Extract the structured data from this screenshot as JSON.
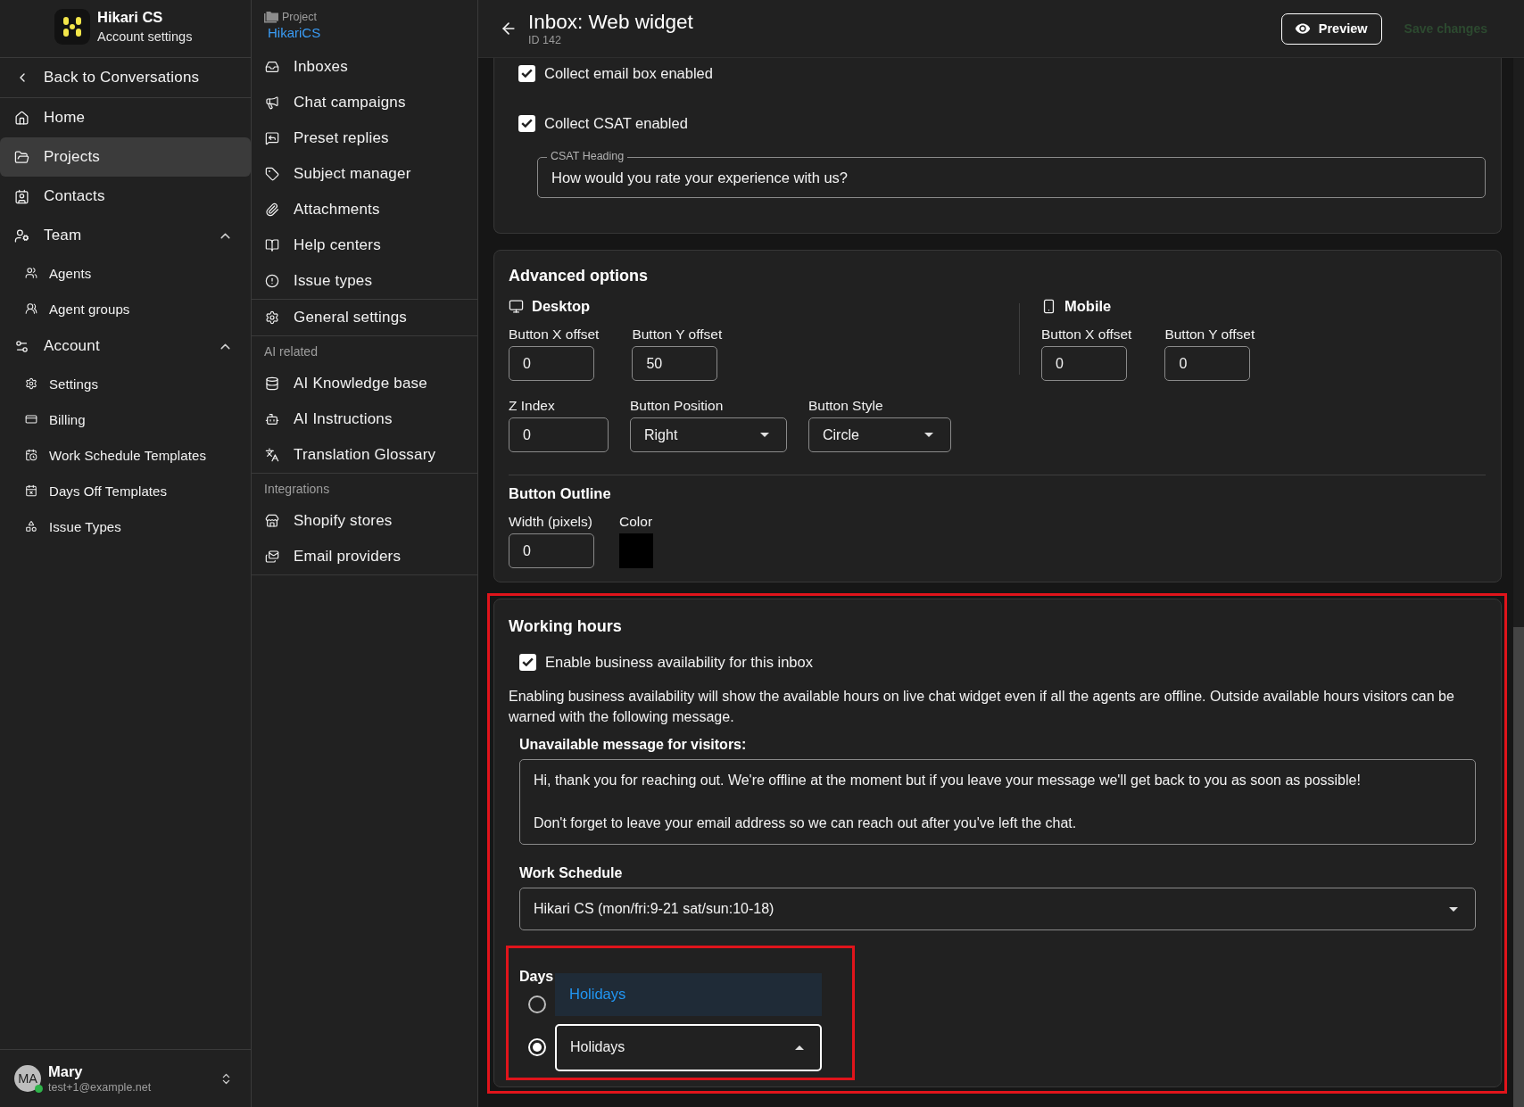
{
  "account_sidebar": {
    "brand": {
      "name": "Hikari CS",
      "subtitle": "Account settings"
    },
    "back_link": "Back to Conversations",
    "items": [
      {
        "label": "Home",
        "selected": false
      },
      {
        "label": "Projects",
        "selected": true
      },
      {
        "label": "Contacts",
        "selected": false
      },
      {
        "label": "Team",
        "selected": false,
        "expanded": true,
        "children": [
          {
            "label": "Agents",
            "selected": false
          },
          {
            "label": "Agent groups",
            "selected": false
          }
        ]
      },
      {
        "label": "Account",
        "selected": false,
        "expanded": true,
        "children": [
          {
            "label": "Settings",
            "selected": false
          },
          {
            "label": "Billing",
            "selected": false
          },
          {
            "label": "Work Schedule Templates",
            "selected": false
          },
          {
            "label": "Days Off Templates",
            "selected": false
          },
          {
            "label": "Issue Types",
            "selected": false
          }
        ]
      }
    ],
    "user": {
      "initials": "MA",
      "name": "Mary",
      "email": "test+1@example.net",
      "online": true
    }
  },
  "project_sidebar": {
    "label": "Project",
    "project": "HikariCS",
    "groups": [
      {
        "items": [
          {
            "label": "Inboxes",
            "selected": false
          },
          {
            "label": "Chat campaigns",
            "selected": false
          },
          {
            "label": "Preset replies",
            "selected": false
          },
          {
            "label": "Subject manager",
            "selected": false
          },
          {
            "label": "Attachments",
            "selected": false
          },
          {
            "label": "Help centers",
            "selected": false
          },
          {
            "label": "Issue types",
            "selected": false
          }
        ]
      },
      {
        "items": [
          {
            "label": "General settings",
            "selected": false
          }
        ]
      },
      {
        "heading": "AI related",
        "items": [
          {
            "label": "AI Knowledge base",
            "selected": false
          },
          {
            "label": "AI Instructions",
            "selected": false
          },
          {
            "label": "Translation Glossary",
            "selected": false
          }
        ]
      },
      {
        "heading": "Integrations",
        "items": [
          {
            "label": "Shopify stores",
            "selected": false
          },
          {
            "label": "Email providers",
            "selected": false
          }
        ]
      }
    ]
  },
  "header": {
    "title": "Inbox: Web widget",
    "subtitle": "ID 142",
    "preview_button": "Preview",
    "save_button": {
      "label": "Save changes",
      "disabled": true
    }
  },
  "widget_settings": {
    "checkboxes": [
      {
        "label": "Collect email box enabled",
        "checked": true
      },
      {
        "label": "Collect CSAT enabled",
        "checked": true
      }
    ],
    "csat_heading": {
      "label": "CSAT Heading",
      "value": "How would you rate your experience with us?"
    }
  },
  "advanced_options": {
    "title": "Advanced options",
    "devices": [
      {
        "kind": "desktop",
        "title": "Desktop",
        "fields": [
          {
            "label": "Button X offset",
            "value": "0"
          },
          {
            "label": "Button Y offset",
            "value": "50"
          }
        ]
      },
      {
        "kind": "mobile",
        "title": "Mobile",
        "fields": [
          {
            "label": "Button X offset",
            "value": "0"
          },
          {
            "label": "Button Y offset",
            "value": "0"
          }
        ]
      }
    ],
    "fields": [
      {
        "kind": "input",
        "label": "Z Index",
        "value": "0"
      },
      {
        "kind": "select",
        "label": "Button Position",
        "value": "Right"
      },
      {
        "kind": "select",
        "label": "Button Style",
        "value": "Circle"
      }
    ],
    "outline": {
      "title": "Button Outline",
      "width": {
        "label": "Width (pixels)",
        "value": "0"
      },
      "color": {
        "label": "Color",
        "color": "#000000"
      }
    }
  },
  "working_hours": {
    "title": "Working hours",
    "enable": {
      "label": "Enable business availability for this inbox",
      "checked": true
    },
    "description": "Enabling business availability will show the available hours on live chat widget even if all the agents are offline. Outside available hours visitors can be warned with the following message.",
    "unavailable_message": {
      "label": "Unavailable message for visitors:",
      "value": "Hi, thank you for reaching out. We're offline at the moment but if you leave your message we'll get back to you as soon as possible!\n\nDon't forget to leave your email address so we can reach out after you've left the chat."
    },
    "work_schedule": {
      "label": "Work Schedule",
      "value": "Hikari CS (mon/fri:9-21 sat/sun:10-18)"
    },
    "days": {
      "label": "Days",
      "options": [
        {
          "selected": false
        },
        {
          "selected": true,
          "value": "Holidays",
          "expanded": true
        }
      ],
      "menu": [
        {
          "label": "Holidays",
          "selected": true
        }
      ]
    }
  }
}
